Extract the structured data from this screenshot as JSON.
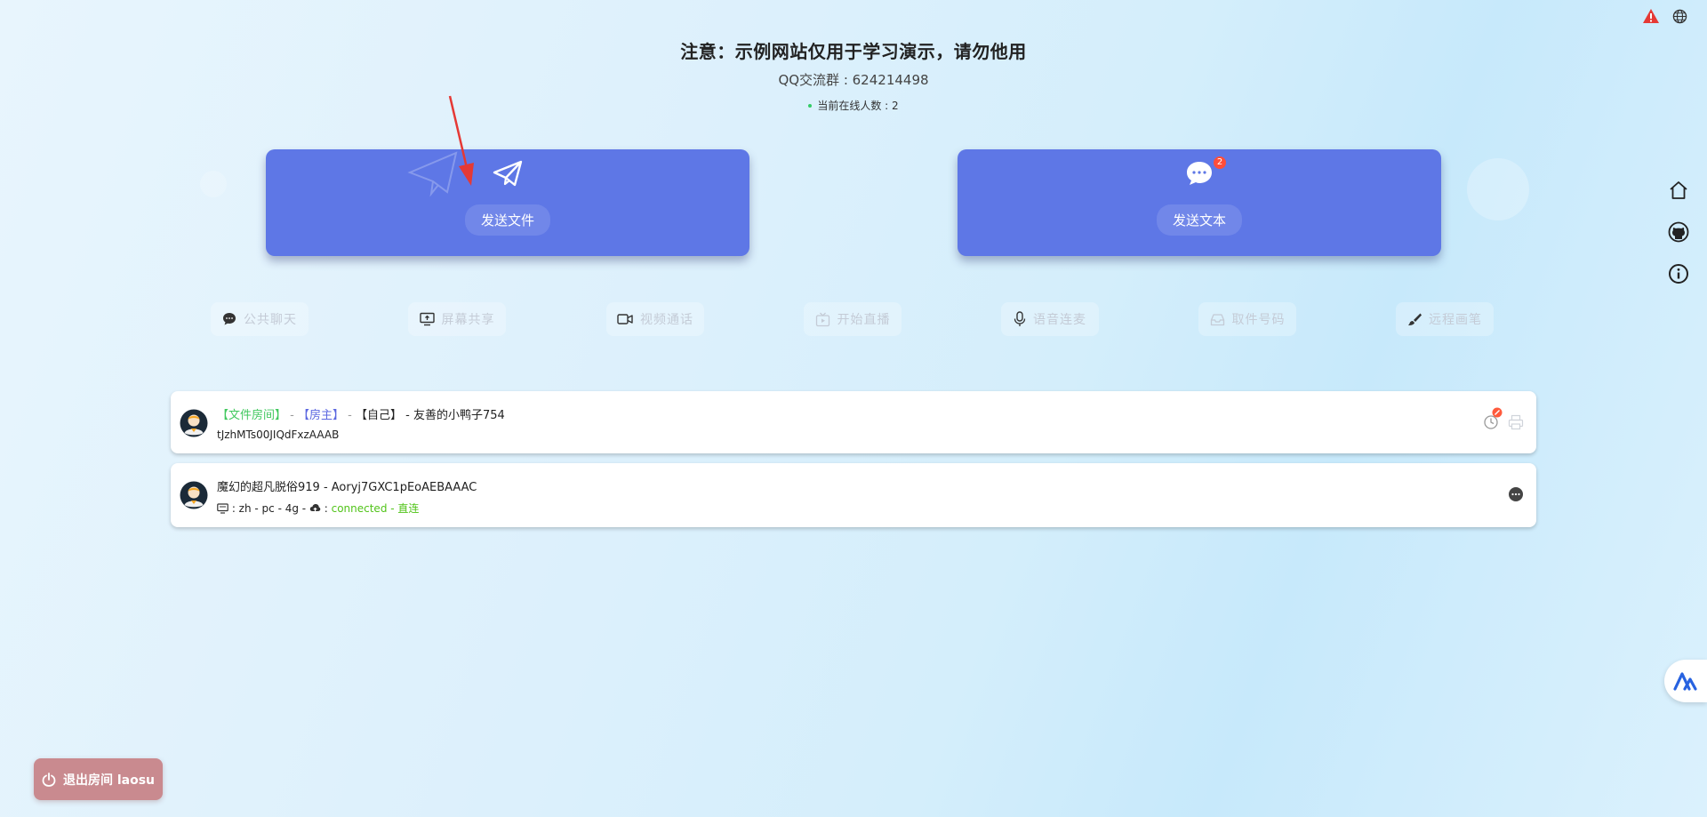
{
  "header": {
    "notice": "注意：示例网站仅用于学习演示，请勿他用",
    "qq_group": "QQ交流群 : 624214498",
    "online_count": "当前在线人数 : 2"
  },
  "cards": {
    "send_file_label": "发送文件",
    "send_text_label": "发送文本",
    "unread_badge": "2"
  },
  "features": [
    {
      "label": "公共聊天",
      "icon": "chat-icon"
    },
    {
      "label": "屏幕共享",
      "icon": "screen-share-icon"
    },
    {
      "label": "视频通话",
      "icon": "video-icon"
    },
    {
      "label": "开始直播",
      "icon": "live-icon"
    },
    {
      "label": "语音连麦",
      "icon": "mic-icon"
    },
    {
      "label": "取件号码",
      "icon": "inbox-icon"
    },
    {
      "label": "远程画笔",
      "icon": "brush-icon"
    }
  ],
  "users": [
    {
      "tag_room": "【文件房间】",
      "sep1": " - ",
      "tag_host": "【房主】",
      "sep2": " - ",
      "tag_self": "【自己】",
      "name": " - 友善的小鸭子754",
      "id": "tJzhMTs00JIQdFxzAAAB"
    },
    {
      "name": "魔幻的超凡脱俗919 - Aoryj7GXC1pEoAEBAAAC",
      "meta": " : zh - pc - 4g - ",
      "meta2": " : ",
      "status": "connected - 直连"
    }
  ],
  "exit": {
    "label": "退出房间 laosu"
  },
  "colors": {
    "card": "#5e77e6",
    "exit": "#c98a8f",
    "connected": "#52c41a",
    "tag_green": "#41c85e",
    "tag_blue": "#5b67e0"
  }
}
